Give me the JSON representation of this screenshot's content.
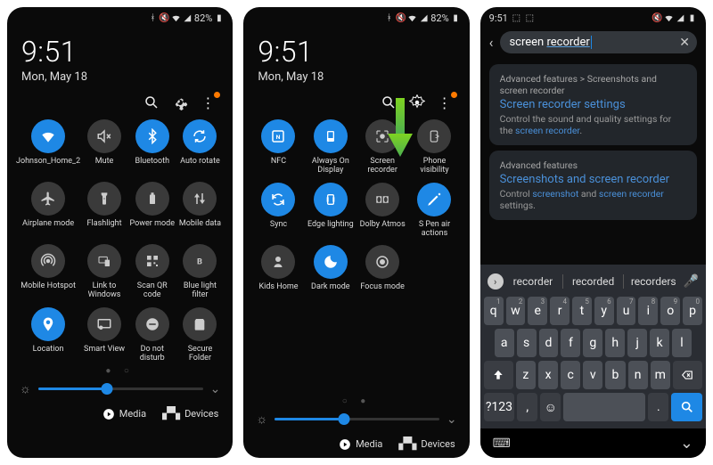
{
  "status": {
    "time": "9:51",
    "battery": "82%"
  },
  "clock": {
    "time": "9:51",
    "date": "Mon, May 18"
  },
  "panel1": {
    "tiles": [
      {
        "label": "Johnson_Home_2",
        "icon": "wifi",
        "on": true
      },
      {
        "label": "Mute",
        "icon": "mute",
        "on": false
      },
      {
        "label": "Bluetooth",
        "icon": "bluetooth",
        "on": true
      },
      {
        "label": "Auto rotate",
        "icon": "rotate",
        "on": true
      },
      {
        "label": "Airplane mode",
        "icon": "airplane",
        "on": false
      },
      {
        "label": "Flashlight",
        "icon": "flashlight",
        "on": false
      },
      {
        "label": "Power mode",
        "icon": "power",
        "on": false
      },
      {
        "label": "Mobile data",
        "icon": "mobiledata",
        "on": false
      },
      {
        "label": "Mobile Hotspot",
        "icon": "hotspot",
        "on": false
      },
      {
        "label": "Link to Windows",
        "icon": "link",
        "on": false
      },
      {
        "label": "Scan QR code",
        "icon": "qr",
        "on": false
      },
      {
        "label": "Blue light filter",
        "icon": "bluelight",
        "on": false
      },
      {
        "label": "Location",
        "icon": "location",
        "on": true
      },
      {
        "label": "Smart View",
        "icon": "smartview",
        "on": false
      },
      {
        "label": "Do not disturb",
        "icon": "dnd",
        "on": false
      },
      {
        "label": "Secure Folder",
        "icon": "secure",
        "on": false
      }
    ],
    "brightness": 42
  },
  "panel2": {
    "tiles": [
      {
        "label": "NFC",
        "icon": "nfc",
        "on": true
      },
      {
        "label": "Always On Display",
        "icon": "aod",
        "on": true
      },
      {
        "label": "Screen recorder",
        "icon": "screenrec",
        "on": false
      },
      {
        "label": "Phone visibility",
        "icon": "visibility",
        "on": false
      },
      {
        "label": "Sync",
        "icon": "sync",
        "on": true
      },
      {
        "label": "Edge lighting",
        "icon": "edge",
        "on": true
      },
      {
        "label": "Dolby Atmos",
        "icon": "dolby",
        "on": false
      },
      {
        "label": "S Pen air actions",
        "icon": "spen",
        "on": true
      },
      {
        "label": "Kids Home",
        "icon": "kids",
        "on": false
      },
      {
        "label": "Dark mode",
        "icon": "darkmode",
        "on": true
      },
      {
        "label": "Focus mode",
        "icon": "focus",
        "on": false
      }
    ],
    "brightness": 42
  },
  "footer": {
    "media": "Media",
    "devices": "Devices"
  },
  "panel3": {
    "search_term_pre": "screen ",
    "search_term_ul": "recorder",
    "results": [
      {
        "crumb": "Advanced features > Screenshots and screen recorder",
        "title_hl": "Screen recorder",
        "title_rest": " settings",
        "desc_pre": "Control the sound and quality settings for the ",
        "desc_hl": "screen recorder",
        "desc_post": "."
      },
      {
        "crumb": "Advanced features",
        "title_parts": [
          "Screen",
          "shots and ",
          "screen recorder"
        ],
        "desc_parts": [
          "Control ",
          "screenshot",
          " and ",
          "screen recorder",
          " settings."
        ]
      }
    ],
    "suggestions": [
      "recorder",
      "recorded",
      "recorders"
    ],
    "rows": {
      "r1": [
        "q",
        "w",
        "e",
        "r",
        "t",
        "y",
        "u",
        "i",
        "o",
        "p"
      ],
      "hints": [
        "1",
        "2",
        "3",
        "4",
        "5",
        "6",
        "7",
        "8",
        "9",
        "0"
      ],
      "r2": [
        "a",
        "s",
        "d",
        "f",
        "g",
        "h",
        "j",
        "k",
        "l"
      ],
      "r3": [
        "z",
        "x",
        "c",
        "v",
        "b",
        "n",
        "m"
      ]
    },
    "sym": "?123"
  }
}
